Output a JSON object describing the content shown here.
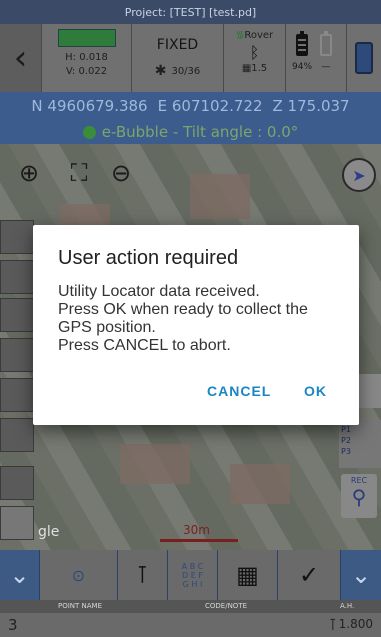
{
  "header": {
    "project": "Project: [TEST] [test.pd]",
    "h_precision": "H: 0.018",
    "v_precision": "V: 0.022",
    "fix_status": "FIXED",
    "satellites": "30/36",
    "rover_label": "Rover",
    "correction_age": "1.5",
    "battery_percent": "94%",
    "battery2": "—",
    "colors": {
      "precision_swatch": "#2e7b3c",
      "coord_bar": "#3b5c8c"
    }
  },
  "coordinates": {
    "north": "N 4960679.386",
    "east": "E 607102.722",
    "z": "Z 175.037"
  },
  "bubble": {
    "text": "e-Bubble - Tilt angle : 0.0°"
  },
  "map": {
    "google_label": "gle",
    "scale_label": "30m",
    "rec_label": "REC",
    "point_lists": [
      "P1",
      "P2",
      "P3"
    ]
  },
  "toolbar": {
    "icons": [
      "chevron-down-icon",
      "target-icon",
      "pole-icon",
      "keyboard-abc-icon",
      "grid-icon",
      "survey-check-icon",
      "chevron-down-icon"
    ],
    "kb_letters": [
      "A B C",
      "D E F",
      "G H I"
    ]
  },
  "fields": {
    "point_name_label": "POINT NAME",
    "code_note_label": "CODE/NOTE",
    "ah_label": "A.H.",
    "point_value": "3",
    "ah_value": "1.800"
  },
  "dialog": {
    "title": "User action required",
    "lines": [
      "Utility Locator data received.",
      "Press OK when ready to collect the",
      "GPS position.",
      "Press CANCEL to abort."
    ],
    "cancel": "CANCEL",
    "ok": "OK"
  }
}
